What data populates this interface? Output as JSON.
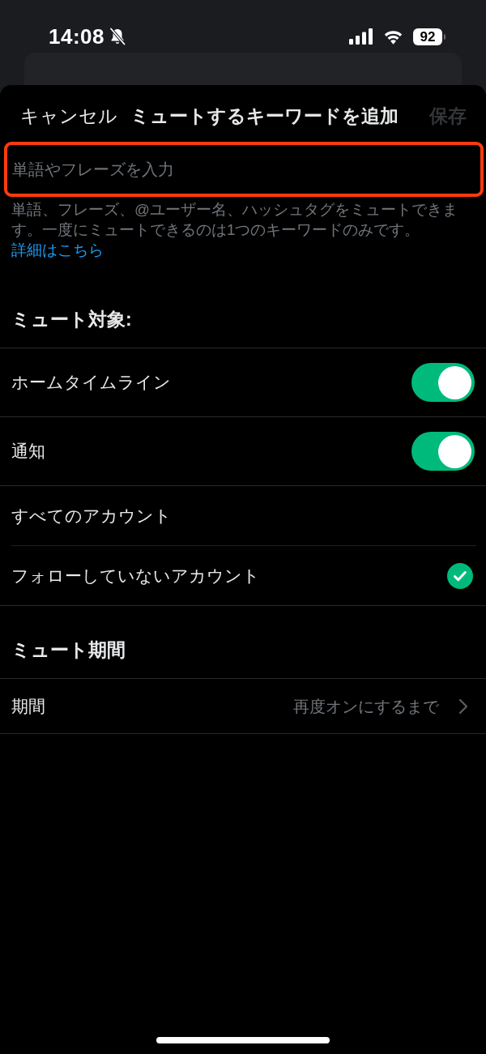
{
  "status_bar": {
    "time": "14:08",
    "silent": true,
    "battery": "92"
  },
  "nav": {
    "cancel": "キャンセル",
    "title": "ミュートするキーワードを追加",
    "save": {
      "label": "保存",
      "disabled": true
    }
  },
  "keyword_field": {
    "placeholder": "単語やフレーズを入力",
    "highlighted": true
  },
  "help": {
    "text": "単語、フレーズ、@ユーザー名、ハッシュタグをミュートできます。一度にミュートできるのは1つのキーワードのみです。",
    "link": "詳細はこちら"
  },
  "sections": [
    {
      "title": "ミュート対象:",
      "rows": [
        {
          "kind": "toggle",
          "label": "ホームタイムライン",
          "on": true
        },
        {
          "kind": "toggle",
          "label": "通知",
          "on": true
        },
        {
          "kind": "choice",
          "label": "すべてのアカウント",
          "selected": false
        },
        {
          "kind": "choice",
          "label": "フォローしていないアカウント",
          "selected": true
        }
      ]
    },
    {
      "title": "ミュート期間",
      "rows": [
        {
          "kind": "value",
          "label": "期間",
          "value": "再度オンにするまで"
        }
      ]
    }
  ]
}
